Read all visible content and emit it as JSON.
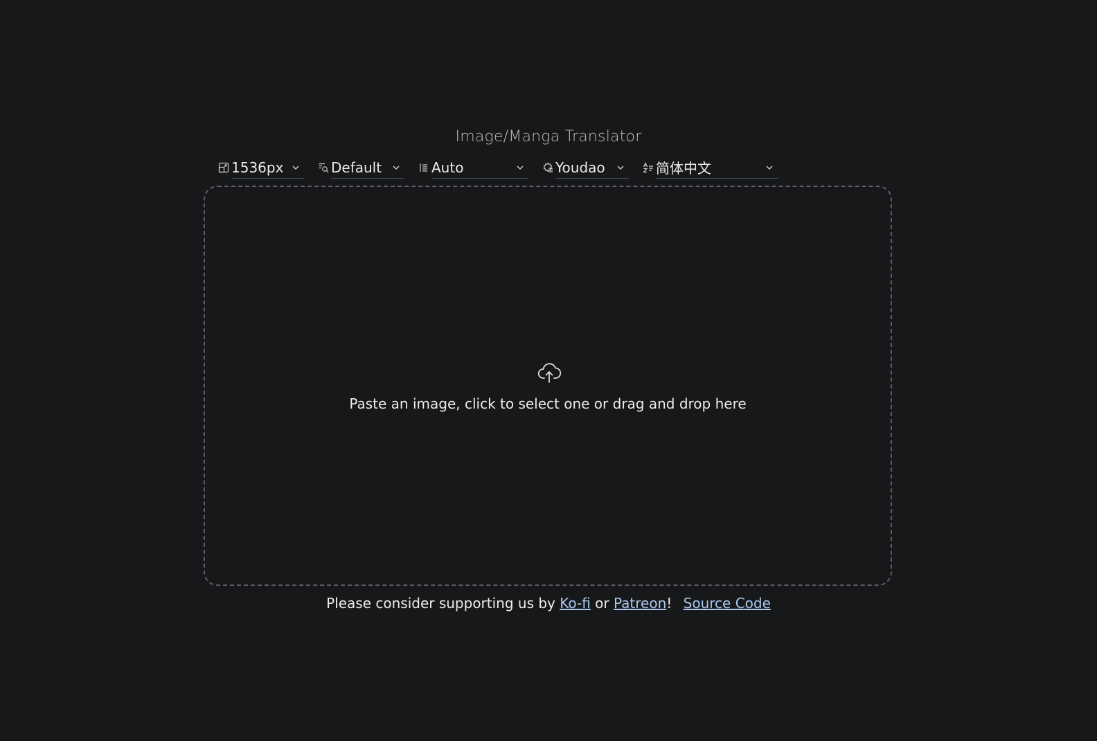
{
  "app": {
    "title": "Image/Manga Translator"
  },
  "toolbar": {
    "size": {
      "icon": "resize-icon",
      "value": "1536px"
    },
    "detector": {
      "icon": "detect-icon",
      "value": "Default"
    },
    "direction": {
      "icon": "text-direction-icon",
      "value": "Auto"
    },
    "translator": {
      "icon": "gear-icon",
      "value": "Youdao"
    },
    "language": {
      "icon": "language-icon",
      "value": "简体中文"
    }
  },
  "dropzone": {
    "icon": "cloud-upload-icon",
    "text": "Paste an image, click to select one or drag and drop here"
  },
  "footer": {
    "prefix": "Please consider supporting us by",
    "kofi": "Ko-fi",
    "or": "or",
    "patreon": "Patreon",
    "exclaim": "!",
    "source_code": "Source Code"
  },
  "colors": {
    "background": "#17181a",
    "link": "#a9c7ef",
    "dashed_border": "#5c5e62"
  }
}
